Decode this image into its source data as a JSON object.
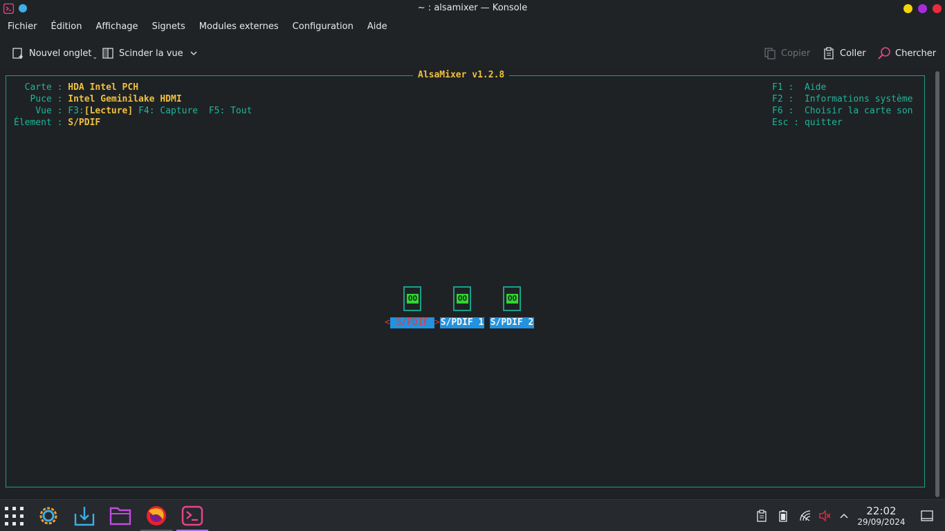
{
  "window": {
    "title": "~ : alsamixer — Konsole",
    "buttons": {
      "minimize_color": "#f5d30c",
      "maximize_color": "#a72ddb",
      "close_color": "#ec2b3d"
    }
  },
  "menubar": [
    "Fichier",
    "Édition",
    "Affichage",
    "Signets",
    "Modules externes",
    "Configuration",
    "Aide"
  ],
  "toolbar": {
    "new_tab": "Nouvel onglet",
    "split_view": "Scinder la vue",
    "copy": "Copier",
    "paste": "Coller",
    "find": "Chercher"
  },
  "terminal": {
    "frame_title": "AlsaMixer v1.2.8",
    "info": {
      "card_label": "  Carte : ",
      "card_value": "HDA Intel PCH",
      "chip_label": "   Puce : ",
      "chip_value": "Intel Geminilake HDMI",
      "view_label": "    Vue : ",
      "view_f3": "F3:",
      "view_current": "[Lecture]",
      "view_rest": " F4: Capture  F5: Tout",
      "item_label": "Élement : ",
      "item_value": "S/PDIF"
    },
    "help": [
      "F1 :  Aide",
      "F2 :  Informations système",
      "F6 :  Choisir la carte son",
      "Esc : quitter"
    ],
    "controls": [
      {
        "mute": "OO",
        "label": " S/PDIF ",
        "active": true
      },
      {
        "mute": "OO",
        "label": "S/PDIF 1",
        "active": false
      },
      {
        "mute": "OO",
        "label": "S/PDIF 2",
        "active": false
      }
    ],
    "arrow_left": "<",
    "arrow_right": ">"
  },
  "taskbar": {
    "apps": [
      "app-launcher-icon",
      "system-settings-icon",
      "discover-icon",
      "dolphin-folder-icon",
      "firefox-icon",
      "konsole-icon"
    ],
    "time": "22:02",
    "date": "29/09/2024"
  },
  "colors": {
    "accent": "#3daee9",
    "terminal_green": "#20b59a",
    "terminal_yellow": "#f0c040",
    "selection_blue": "#2392e0"
  }
}
